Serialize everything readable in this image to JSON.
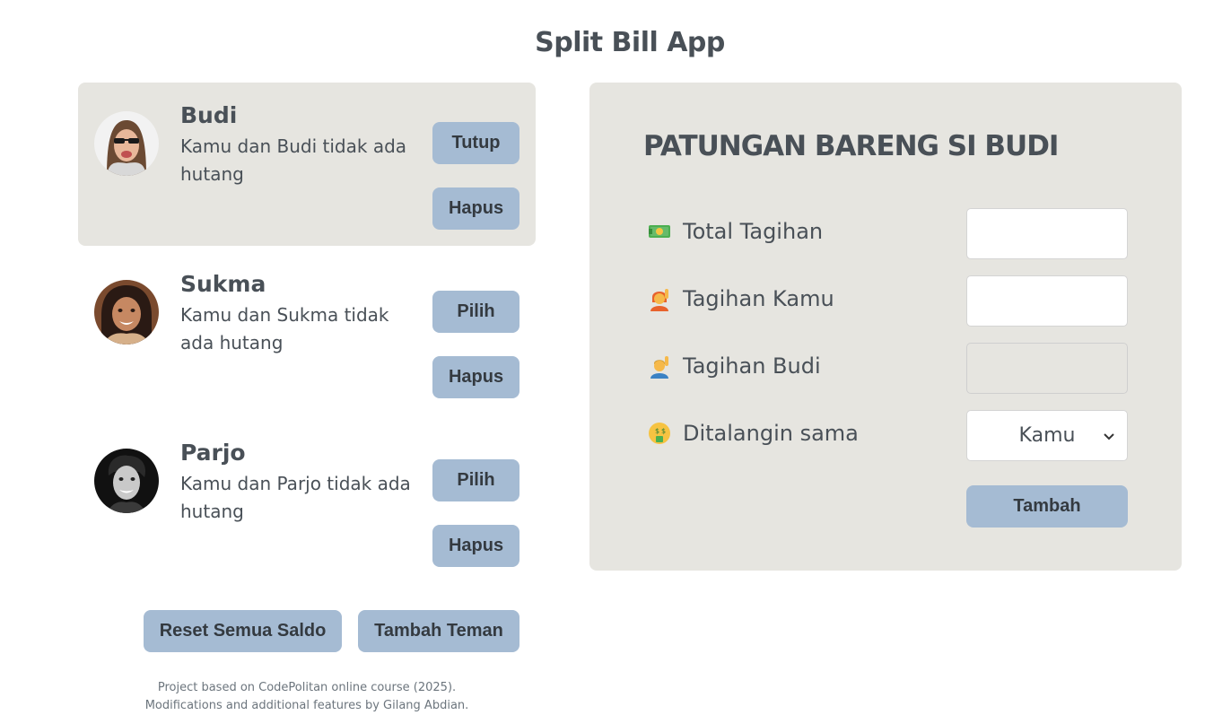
{
  "app": {
    "title": "Split Bill App"
  },
  "friends": [
    {
      "name": "Budi",
      "status": "Kamu dan Budi tidak ada hutang",
      "select_label": "Tutup",
      "delete_label": "Hapus",
      "selected": true
    },
    {
      "name": "Sukma",
      "status": "Kamu dan Sukma tidak ada hutang",
      "select_label": "Pilih",
      "delete_label": "Hapus",
      "selected": false
    },
    {
      "name": "Parjo",
      "status": "Kamu dan Parjo tidak ada hutang",
      "select_label": "Pilih",
      "delete_label": "Hapus",
      "selected": false
    }
  ],
  "actions": {
    "reset_label": "Reset Semua Saldo",
    "add_friend_label": "Tambah Teman"
  },
  "footer": {
    "line1": "Project based on CodePolitan online course (2025).",
    "line2": "Modifications and additional features by Gilang Abdian."
  },
  "split_form": {
    "title": "PATUNGAN BARENG SI BUDI",
    "total_label": "Total Tagihan",
    "total_value": "",
    "your_bill_label": "Tagihan Kamu",
    "your_bill_value": "",
    "friend_bill_label": "Tagihan Budi",
    "friend_bill_value": "",
    "payer_label": "Ditalangin sama",
    "payer_value": "Kamu",
    "submit_label": "Tambah",
    "icons": [
      "money-icon",
      "raising-hand-woman-icon",
      "raising-hand-man-icon",
      "money-mouth-face-icon"
    ]
  },
  "colors": {
    "button": "#a5bbd3",
    "panel": "#e6e5e0",
    "text": "#495057"
  }
}
